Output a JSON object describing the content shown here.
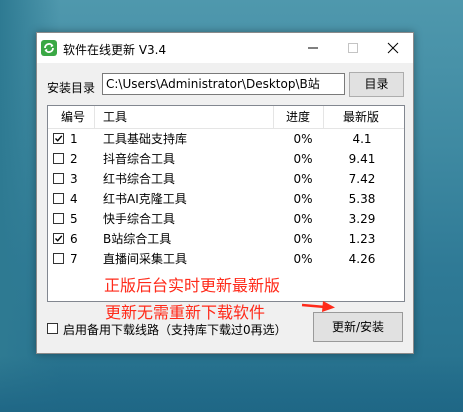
{
  "window": {
    "title": "软件在线更新 V3.4",
    "icon": "refresh-icon"
  },
  "install_dir": {
    "label": "安装目录",
    "value": "C:\\Users\\Administrator\\Desktop\\B站",
    "browse_label": "目录"
  },
  "table": {
    "headers": {
      "num": "编号",
      "tool": "工具",
      "progress": "进度",
      "version": "最新版"
    },
    "rows": [
      {
        "checked": true,
        "num": "1",
        "tool": "工具基础支持库",
        "progress": "0%",
        "version": "4.1"
      },
      {
        "checked": false,
        "num": "2",
        "tool": "抖音综合工具",
        "progress": "0%",
        "version": "9.41"
      },
      {
        "checked": false,
        "num": "3",
        "tool": "红书综合工具",
        "progress": "0%",
        "version": "7.42"
      },
      {
        "checked": false,
        "num": "4",
        "tool": "红书AI克隆工具",
        "progress": "0%",
        "version": "5.38"
      },
      {
        "checked": false,
        "num": "5",
        "tool": "快手综合工具",
        "progress": "0%",
        "version": "3.29"
      },
      {
        "checked": true,
        "num": "6",
        "tool": "B站综合工具",
        "progress": "0%",
        "version": "1.23"
      },
      {
        "checked": false,
        "num": "7",
        "tool": "直播间采集工具",
        "progress": "0%",
        "version": "4.26"
      }
    ]
  },
  "backup_route": {
    "checked": false,
    "label": "启用备用下载线路（支持库下载过0再选）"
  },
  "install_button": "更新/安装",
  "annotation": {
    "line1": "正版后台实时更新最新版",
    "line2": "更新无需重新下载软件",
    "color": "#ff2a1a"
  }
}
